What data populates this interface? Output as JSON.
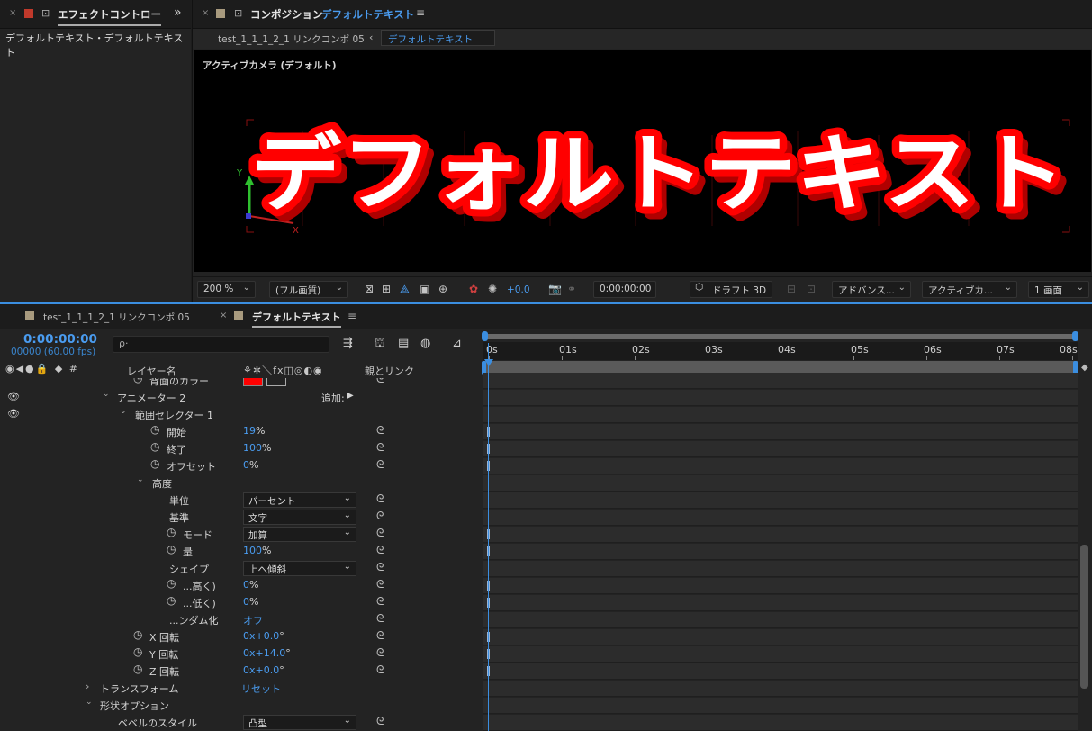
{
  "effects_panel": {
    "close": "×",
    "tab_label": "エフェクトコントロー",
    "more": "»",
    "subtitle": "デフォルトテキスト・デフォルトテキスト"
  },
  "comp_panel": {
    "close": "×",
    "tab_label": "コンポジション",
    "tab_name": "デフォルトテキスト",
    "menu": "≡",
    "breadcrumb": [
      "test_1_1_1_2_1 リンクコンポ 05",
      "デフォルトテキスト"
    ],
    "breadcrumb_sep": "‹",
    "camera_label": "アクティブカメラ (デフォルト)",
    "canvas_text": "デフォルトテキスト",
    "axis_labels": {
      "y": "Y",
      "x": "X"
    },
    "toolbar": {
      "zoom": "200 %",
      "quality": "(フル画質)",
      "exposure": "+0.0",
      "timecode": "0:00:00:00",
      "draft3d": "ドラフト 3D",
      "renderer": "アドバンス...",
      "camera": "アクティブカ...",
      "views": "1 画面"
    },
    "accent_color": "#4a9cf0",
    "text_fill": "#ffffff",
    "text_stroke": "#ff0000"
  },
  "timeline": {
    "tabs": [
      {
        "label": "test_1_1_1_2_1 リンクコンポ 05"
      },
      {
        "label": "デフォルトテキスト",
        "close": "×",
        "menu": "≡"
      }
    ],
    "timecode": "0:00:00:00",
    "fps": "00000 (60.00 fps)",
    "search_placeholder": "ρ·",
    "columns": {
      "icons": "◉◀●🔒  ◆  #",
      "layer_name": "レイヤー名",
      "switches": "⚘✲＼fx◫◎◐◉",
      "parent": "親とリンク"
    },
    "add_label": "追加:",
    "rows": [
      {
        "label": "背面のカラー",
        "type": "color"
      },
      {
        "label": "アニメーター 2",
        "twirl": "⌄",
        "eye": true,
        "add": true
      },
      {
        "label": "範囲セレクター 1",
        "twirl": "⌄",
        "eye": true
      },
      {
        "label": "開始",
        "stopwatch": true,
        "value": "19",
        "unit": "%"
      },
      {
        "label": "終了",
        "stopwatch": true,
        "value": "100",
        "unit": "%"
      },
      {
        "label": "オフセット",
        "stopwatch": true,
        "value": "0",
        "unit": "%"
      },
      {
        "label": "高度",
        "twirl": "⌄"
      },
      {
        "label": "単位",
        "dropdown": "パーセント"
      },
      {
        "label": "基準",
        "dropdown": "文字"
      },
      {
        "label": "モード",
        "stopwatch": true,
        "dropdown": "加算"
      },
      {
        "label": "量",
        "stopwatch": true,
        "value": "100",
        "unit": "%"
      },
      {
        "label": "シェイプ",
        "dropdown": "上へ傾斜"
      },
      {
        "label": "...高く)",
        "stopwatch": true,
        "value": "0",
        "unit": "%"
      },
      {
        "label": "...低く)",
        "stopwatch": true,
        "value": "0",
        "unit": "%"
      },
      {
        "label": "...ンダム化",
        "value": "オフ",
        "unit": ""
      },
      {
        "label": "X 回転",
        "stopwatch": true,
        "value": "0x+0.0",
        "unit": "°"
      },
      {
        "label": "Y 回転",
        "stopwatch": true,
        "value": "0x+14.0",
        "unit": "°"
      },
      {
        "label": "Z 回転",
        "stopwatch": true,
        "value": "0x+0.0",
        "unit": "°"
      },
      {
        "label": "トランスフォーム",
        "twirl": "›",
        "value": "リセット",
        "unit": ""
      },
      {
        "label": "形状オプション",
        "twirl": "⌄"
      },
      {
        "label": "ベベルのスタイル",
        "dropdown": "凸型"
      }
    ],
    "ruler_ticks": [
      "0s",
      "01s",
      "02s",
      "03s",
      "04s",
      "05s",
      "06s",
      "07s",
      "08s"
    ],
    "layer_bar_color": "#4ac04a",
    "playhead_color": "#3b8ee0"
  }
}
